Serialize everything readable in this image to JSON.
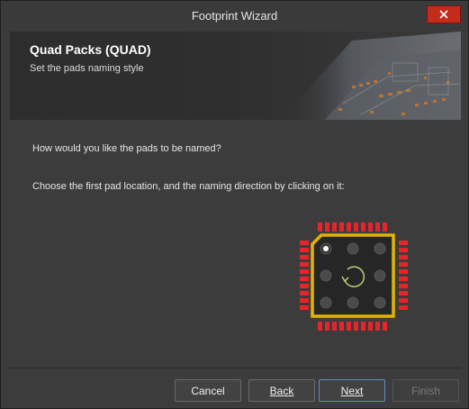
{
  "window": {
    "title": "Footprint Wizard"
  },
  "header": {
    "title": "Quad Packs (QUAD)",
    "subtitle": "Set the pads naming style"
  },
  "content": {
    "question": "How would you like the pads to be named?",
    "instruction": "Choose the first pad location, and the naming direction by clicking on it:"
  },
  "footer": {
    "cancel_label": "Cancel",
    "back_label": "Back",
    "next_label": "Next",
    "finish_label": "Finish"
  },
  "colors": {
    "pad_red": "#e8242b",
    "body_outline": "#e0b400",
    "close_red": "#c42b1c",
    "default_button_border": "#5b8ec7"
  },
  "icons": [
    "close-icon",
    "rotate-direction-icon"
  ]
}
